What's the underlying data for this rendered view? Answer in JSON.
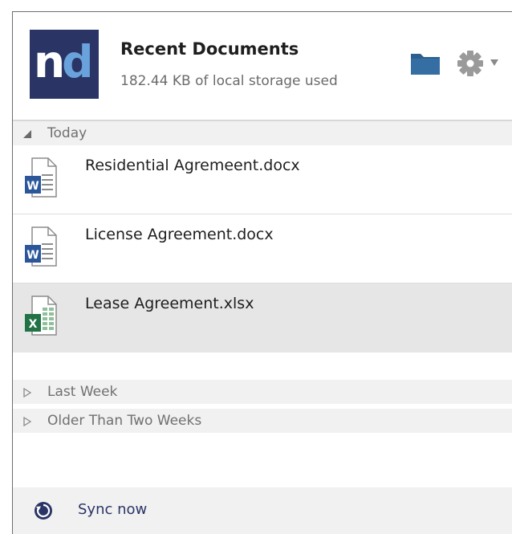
{
  "header": {
    "logo_text_n": "n",
    "logo_text_d": "d",
    "title": "Recent Documents",
    "storage_status": "182.44 KB of local storage used",
    "folder_icon": "folder-icon",
    "settings_icon": "gear-icon"
  },
  "colors": {
    "logo_bg": "#2a3566",
    "logo_accent": "#6aa3dc",
    "folder": "#2c5f8e",
    "gear": "#9a9a9a",
    "word": "#2b579a",
    "excel": "#217346",
    "group_bg": "#f1f1f1",
    "selected_row": "#e6e6e6",
    "sync": "#2a3566"
  },
  "groups": [
    {
      "label": "Today",
      "expanded": true,
      "items": [
        {
          "name": "Residential Agremeent.docx",
          "type": "word",
          "icon": "word-document-icon",
          "selected": false
        },
        {
          "name": "License Agreement.docx",
          "type": "word",
          "icon": "word-document-icon",
          "selected": false
        },
        {
          "name": "Lease Agreement.xlsx",
          "type": "excel",
          "icon": "excel-spreadsheet-icon",
          "selected": true
        }
      ]
    },
    {
      "label": "Last Week",
      "expanded": false,
      "items": []
    },
    {
      "label": "Older Than Two Weeks",
      "expanded": false,
      "items": []
    }
  ],
  "footer": {
    "sync_label": "Sync now",
    "sync_icon": "sync-icon"
  }
}
